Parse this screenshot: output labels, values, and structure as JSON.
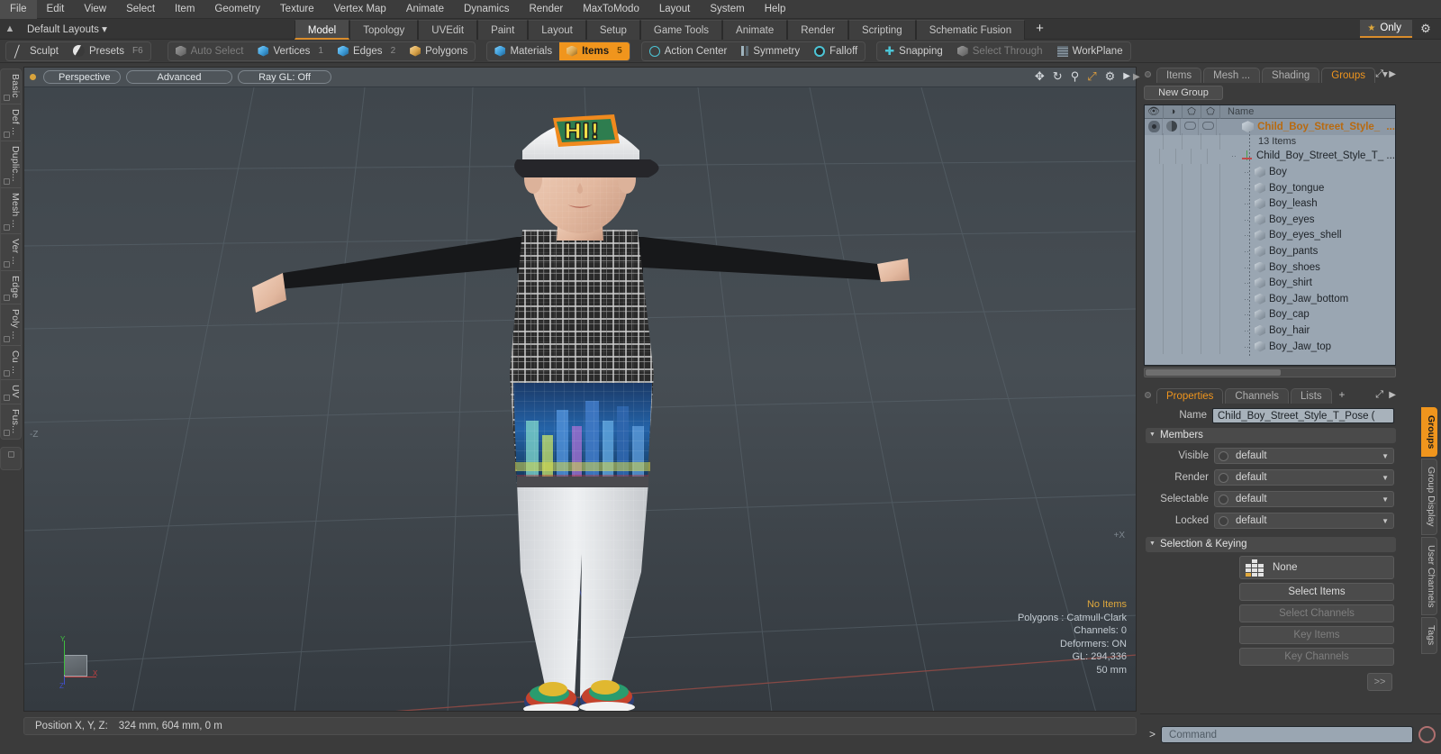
{
  "menu": {
    "items": [
      "File",
      "Edit",
      "View",
      "Select",
      "Item",
      "Geometry",
      "Texture",
      "Vertex Map",
      "Animate",
      "Dynamics",
      "Render",
      "MaxToModo",
      "Layout",
      "System",
      "Help"
    ]
  },
  "layout_bar": {
    "home_icon": "home-icon",
    "default_layouts": "Default Layouts ▾",
    "tabs": [
      {
        "label": "Model",
        "active": true
      },
      {
        "label": "Topology",
        "active": false
      },
      {
        "label": "UVEdit",
        "active": false
      },
      {
        "label": "Paint",
        "active": false
      },
      {
        "label": "Layout",
        "active": false
      },
      {
        "label": "Setup",
        "active": false
      },
      {
        "label": "Game Tools",
        "active": false
      },
      {
        "label": "Animate",
        "active": false
      },
      {
        "label": "Render",
        "active": false
      },
      {
        "label": "Scripting",
        "active": false
      },
      {
        "label": "Schematic Fusion",
        "active": false
      }
    ],
    "add_tab": "+",
    "only_label": "Only",
    "star_icon": "star-icon",
    "gear_icon": "gear-icon"
  },
  "mode_bar": {
    "group_a": [
      {
        "label": "Sculpt",
        "icon": "pencil-icon",
        "state": "normal",
        "shortcut": ""
      },
      {
        "label": "Presets",
        "icon": "sphere-icon",
        "state": "normal",
        "shortcut": "F6"
      }
    ],
    "group_b": [
      {
        "label": "Auto Select",
        "icon": "cube-gray-icon",
        "state": "dim",
        "num": ""
      },
      {
        "label": "Vertices",
        "icon": "cube-blue-icon",
        "state": "normal",
        "num": "1"
      },
      {
        "label": "Edges",
        "icon": "cube-blue-icon",
        "state": "normal",
        "num": "2"
      },
      {
        "label": "Polygons",
        "icon": "cube-gold-icon",
        "state": "normal",
        "num": ""
      }
    ],
    "group_c": [
      {
        "label": "Materials",
        "icon": "cube-blue-icon",
        "state": "normal",
        "num": ""
      },
      {
        "label": "Items",
        "icon": "cube-gold-icon",
        "state": "selected",
        "num": "5"
      }
    ],
    "group_d": [
      {
        "label": "Action Center",
        "icon": "crosshair-icon",
        "state": "normal"
      },
      {
        "label": "Symmetry",
        "icon": "bars-icon",
        "state": "normal"
      },
      {
        "label": "Falloff",
        "icon": "circle-icon",
        "state": "normal"
      }
    ],
    "group_e": [
      {
        "label": "Snapping",
        "icon": "plus-icon",
        "state": "normal"
      },
      {
        "label": "Select Through",
        "icon": "cube-gray-icon",
        "state": "dim"
      },
      {
        "label": "WorkPlane",
        "icon": "grid-icon",
        "state": "normal"
      }
    ]
  },
  "left_toolbar": {
    "tabs": [
      "Basic",
      "Def ...",
      "Duplic...",
      "Mesh ...",
      "Ver ...",
      "Edge",
      "Poly ...",
      "Cu ...",
      "UV",
      "Fus..."
    ]
  },
  "viewport": {
    "dot": "viewport-active-dot",
    "pills": [
      "Perspective",
      "Advanced",
      "Ray GL: Off"
    ],
    "icons": [
      "move-icon",
      "rotate-icon",
      "zoom-icon",
      "fit-icon",
      "gear-icon"
    ],
    "axis_labels": {
      "x": "X",
      "y": "Y",
      "z": "Z",
      "neg_z": "-Z",
      "neg_x": "+X"
    },
    "stats": {
      "title": "No Items",
      "lines": [
        "Polygons : Catmull-Clark",
        "Channels: 0",
        "Deformers: ON",
        "GL: 294,336",
        "50 mm"
      ]
    }
  },
  "status_bar": {
    "position_label": "Position X, Y, Z:",
    "position_value": "324 mm, 604 mm, 0 m"
  },
  "right_panel": {
    "tabs": [
      {
        "label": "Items",
        "active": false
      },
      {
        "label": "Mesh ...",
        "active": false
      },
      {
        "label": "Shading",
        "active": false
      },
      {
        "label": "Groups",
        "active": true
      }
    ],
    "caret": "▾",
    "new_group_button": "New Group",
    "column_headers": {
      "eye": "visibility-column",
      "shade": "shading-column",
      "render": "render-column",
      "select": "select-column",
      "name": "Name"
    },
    "group_row": {
      "name": "Child_Boy_Street_Style_",
      "sub": "13 Items"
    },
    "items": [
      {
        "name": "Child_Boy_Street_Style_T_ ...",
        "icon": "locator-icon"
      },
      {
        "name": "Boy",
        "icon": "mesh-icon"
      },
      {
        "name": "Boy_tongue",
        "icon": "mesh-icon"
      },
      {
        "name": "Boy_leash",
        "icon": "mesh-icon"
      },
      {
        "name": "Boy_eyes",
        "icon": "mesh-icon"
      },
      {
        "name": "Boy_eyes_shell",
        "icon": "mesh-icon"
      },
      {
        "name": "Boy_pants",
        "icon": "mesh-icon"
      },
      {
        "name": "Boy_shoes",
        "icon": "mesh-icon"
      },
      {
        "name": "Boy_shirt",
        "icon": "mesh-icon"
      },
      {
        "name": "Boy_Jaw_bottom",
        "icon": "mesh-icon"
      },
      {
        "name": "Boy_cap",
        "icon": "mesh-icon"
      },
      {
        "name": "Boy_hair",
        "icon": "mesh-icon"
      },
      {
        "name": "Boy_Jaw_top",
        "icon": "mesh-icon"
      }
    ]
  },
  "properties": {
    "tabs": [
      {
        "label": "Properties",
        "active": true
      },
      {
        "label": "Channels",
        "active": false
      },
      {
        "label": "Lists",
        "active": false
      },
      {
        "label": "+",
        "active": false
      }
    ],
    "name_label": "Name",
    "name_value": "Child_Boy_Street_Style_T_Pose (",
    "members_section": "Members",
    "members": [
      {
        "label": "Visible",
        "value": "default"
      },
      {
        "label": "Render",
        "value": "default"
      },
      {
        "label": "Selectable",
        "value": "default"
      },
      {
        "label": "Locked",
        "value": "default"
      }
    ],
    "selection_section": "Selection & Keying",
    "selection_none": "None",
    "buttons": [
      {
        "label": "Select Items",
        "enabled": true
      },
      {
        "label": "Select Channels",
        "enabled": false
      },
      {
        "label": "Key Items",
        "enabled": false
      },
      {
        "label": "Key Channels",
        "enabled": false
      }
    ],
    "more_button": ">>"
  },
  "right_vtabs": [
    {
      "label": "Groups",
      "active": true
    },
    {
      "label": "Group Display",
      "active": false
    },
    {
      "label": "User Channels",
      "active": false
    },
    {
      "label": "Tags",
      "active": false
    }
  ],
  "command_bar": {
    "prompt": ">",
    "placeholder": "Command",
    "record_icon": "record-icon"
  },
  "colors": {
    "accent_orange": "#f0951d",
    "tab_underline": "#d98c2b",
    "panel_bg": "#3b3b3b",
    "list_bg": "#9aa6b2",
    "viewport_bg": "#3a4045",
    "status_highlight": "#e0a83c"
  }
}
